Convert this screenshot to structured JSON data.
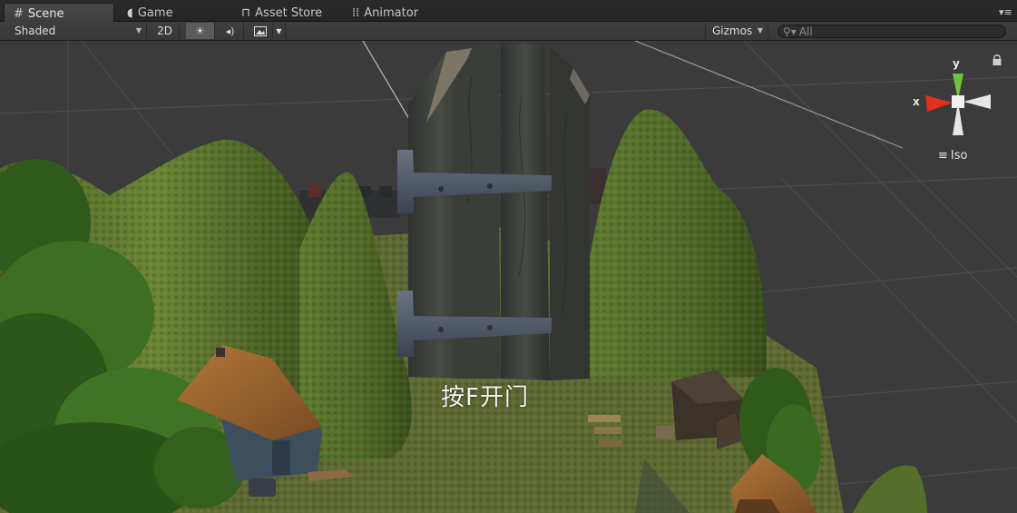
{
  "tabs": [
    {
      "label": "Scene",
      "icon": "scene-grid-icon",
      "active": true
    },
    {
      "label": "Game",
      "icon": "game-pacman-icon",
      "active": false
    },
    {
      "label": "Asset Store",
      "icon": "store-bag-icon",
      "active": false
    },
    {
      "label": "Animator",
      "icon": "animator-nodes-icon",
      "active": false
    }
  ],
  "toolbar": {
    "draw_mode": "Shaded",
    "mode_2d": "2D",
    "gizmos_label": "Gizmos",
    "search_placeholder": "All"
  },
  "scene": {
    "prompt_text": "按F开门",
    "gizmo_y": "y",
    "gizmo_x": "x",
    "projection": "Iso"
  },
  "colors": {
    "gizmo_x": "#e0301e",
    "gizmo_y": "#6ec43a",
    "hills": "#566e2c",
    "grass": "#5f6a33",
    "door": "#3c3f3a"
  }
}
